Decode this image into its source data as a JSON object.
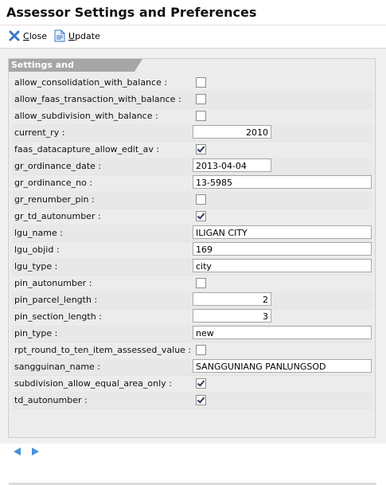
{
  "window": {
    "title": "Assessor Settings and Preferences"
  },
  "toolbar": {
    "close": {
      "key": "C",
      "rest": "lose",
      "icon": "close-x-icon"
    },
    "update": {
      "key": "U",
      "rest": "pdate",
      "icon": "document-icon"
    }
  },
  "section": {
    "title": "Settings and Configurations"
  },
  "settings": [
    {
      "label": "allow_consolidation_with_balance :",
      "type": "checkbox",
      "checked": false
    },
    {
      "label": "allow_faas_transaction_with_balance :",
      "type": "checkbox",
      "checked": false
    },
    {
      "label": "allow_subdivision_with_balance :",
      "type": "checkbox",
      "checked": false
    },
    {
      "label": "current_ry :",
      "type": "number",
      "value": "2010"
    },
    {
      "label": "faas_datacapture_allow_edit_av :",
      "type": "checkbox",
      "checked": true
    },
    {
      "label": "gr_ordinance_date :",
      "type": "date",
      "value": "2013-04-04"
    },
    {
      "label": "gr_ordinance_no :",
      "type": "text",
      "value": "13-5985"
    },
    {
      "label": "gr_renumber_pin :",
      "type": "checkbox",
      "checked": false
    },
    {
      "label": "gr_td_autonumber :",
      "type": "checkbox",
      "checked": true
    },
    {
      "label": "lgu_name :",
      "type": "text",
      "value": "ILIGAN CITY"
    },
    {
      "label": "lgu_objid :",
      "type": "text",
      "value": "169"
    },
    {
      "label": "lgu_type :",
      "type": "text",
      "value": "city"
    },
    {
      "label": "pin_autonumber :",
      "type": "checkbox",
      "checked": false
    },
    {
      "label": "pin_parcel_length :",
      "type": "number",
      "value": "2"
    },
    {
      "label": "pin_section_length :",
      "type": "number",
      "value": "3"
    },
    {
      "label": "pin_type :",
      "type": "text",
      "value": "new"
    },
    {
      "label": "rpt_round_to_ten_item_assessed_value :",
      "type": "checkbox",
      "checked": false
    },
    {
      "label": "sangguinan_name :",
      "type": "text",
      "value": "SANGGUNIANG PANLUNGSOD"
    },
    {
      "label": "subdivision_allow_equal_area_only :",
      "type": "checkbox",
      "checked": true
    },
    {
      "label": "td_autonumber :",
      "type": "checkbox",
      "checked": true
    }
  ],
  "colors": {
    "header_bg": "#a6a6a6",
    "check_color": "#2d3e56",
    "nav_arrow": "#4a90d9"
  }
}
